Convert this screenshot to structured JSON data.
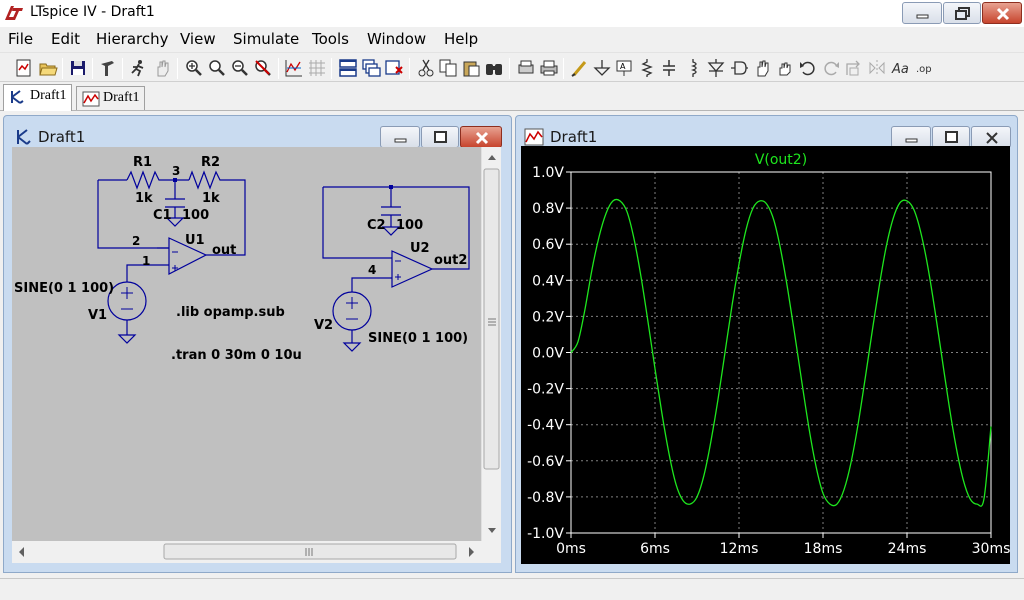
{
  "window": {
    "title": "LTspice IV - Draft1",
    "app_icon": "ltspice-logo-icon"
  },
  "menu": [
    "File",
    "Edit",
    "Hierarchy",
    "View",
    "Simulate",
    "Tools",
    "Window",
    "Help"
  ],
  "toolbar_icons": [
    "new-schematic-icon",
    "open-icon",
    "save-icon",
    "control-panel-icon",
    "run-icon",
    "halt-icon",
    "zoom-in-icon",
    "zoom-area-icon",
    "zoom-out-icon",
    "zoom-cancel-icon",
    "autorange-icon",
    "grid-icon",
    "tile-horizontal-icon",
    "cascade-icon",
    "close-all-icon",
    "cut-icon",
    "copy-icon",
    "find-icon",
    "print-preview-icon",
    "print-icon",
    "draw-wire-icon",
    "ground-icon",
    "label-net-icon",
    "resistor-icon",
    "capacitor-icon",
    "inductor-icon",
    "diode-icon",
    "component-icon",
    "move-icon",
    "drag-icon",
    "undo-icon",
    "redo-icon",
    "rotate-icon",
    "mirror-icon",
    "text-icon",
    "spice-directive-icon"
  ],
  "tabs": [
    {
      "label": "Draft1",
      "icon": "schematic-icon",
      "active": true
    },
    {
      "label": "Draft1",
      "icon": "waveform-icon",
      "active": false
    }
  ],
  "schematic_window": {
    "title": "Draft1",
    "labels": {
      "r1": "R1",
      "r1_val": "1k",
      "r2": "R2",
      "r2_val": "1k",
      "node3": "3",
      "c1": "C1",
      "c1_val": "100",
      "node2": "2",
      "u1": "U1",
      "node1": "1",
      "out": "out",
      "v1_src": "SINE(0 1 100)",
      "v1": "V1",
      "lib": ".lib opamp.sub",
      "tran": ".tran 0 30m 0 10u",
      "c2": "C2",
      "c2_val": "100",
      "u2": "U2",
      "node4": "4",
      "out2": "out2",
      "v2": "V2",
      "v2_src": "SINE(0 1 100)"
    }
  },
  "plot_window": {
    "title": "Draft1",
    "colors": {
      "trace": "#1ee61e",
      "grid": "#808080",
      "axis_text": "#ffffff",
      "background": "#000000"
    }
  },
  "chart_data": {
    "type": "line",
    "title": "V(out2)",
    "xlabel": "",
    "ylabel": "",
    "x_ticks": [
      "0ms",
      "6ms",
      "12ms",
      "18ms",
      "24ms",
      "30ms"
    ],
    "y_ticks": [
      "1.0V",
      "0.8V",
      "0.6V",
      "0.4V",
      "0.2V",
      "0.0V",
      "-0.2V",
      "-0.4V",
      "-0.6V",
      "-0.8V",
      "-1.0V"
    ],
    "xlim": [
      0,
      30
    ],
    "ylim": [
      -1.0,
      1.0
    ],
    "grid": true,
    "series": [
      {
        "name": "V(out2)",
        "x_unit": "ms",
        "x": [
          0,
          0.5,
          1,
          1.5,
          2,
          2.5,
          3,
          3.5,
          4,
          4.5,
          5,
          5.5,
          6,
          6.5,
          7,
          7.5,
          8,
          8.5,
          9,
          9.5,
          10,
          10.5,
          11,
          11.5,
          12,
          12.5,
          13,
          13.5,
          14,
          14.5,
          15,
          15.5,
          16,
          16.5,
          17,
          17.5,
          18,
          18.5,
          19,
          19.5,
          20,
          20.5,
          21,
          21.5,
          22,
          22.5,
          23,
          23.5,
          24,
          24.5,
          25,
          25.5,
          26,
          26.5,
          27,
          27.5,
          28,
          28.5,
          29,
          29.5,
          30
        ],
        "y": [
          0.0,
          0.06,
          0.24,
          0.46,
          0.64,
          0.77,
          0.84,
          0.84,
          0.78,
          0.63,
          0.42,
          0.17,
          -0.09,
          -0.34,
          -0.56,
          -0.73,
          -0.82,
          -0.84,
          -0.8,
          -0.68,
          -0.49,
          -0.26,
          0.0,
          0.26,
          0.49,
          0.68,
          0.8,
          0.84,
          0.82,
          0.73,
          0.56,
          0.34,
          0.09,
          -0.17,
          -0.42,
          -0.63,
          -0.78,
          -0.84,
          -0.84,
          -0.76,
          -0.61,
          -0.4,
          -0.15,
          0.11,
          0.36,
          0.58,
          0.74,
          0.83,
          0.84,
          0.79,
          0.66,
          0.47,
          0.23,
          -0.03,
          -0.29,
          -0.52,
          -0.7,
          -0.81,
          -0.84,
          -0.81,
          -0.41
        ]
      }
    ]
  }
}
